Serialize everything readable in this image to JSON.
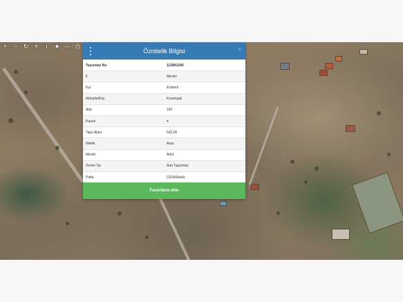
{
  "toolbar": {
    "icons": [
      "plus-icon",
      "minus-icon",
      "refresh-icon",
      "locate-icon",
      "info-icon",
      "star-icon",
      "measure-icon",
      "print-icon"
    ],
    "glyphs": [
      "+",
      "−",
      "↻",
      "⌖",
      "i",
      "★",
      "—",
      "⎙"
    ]
  },
  "dialog": {
    "title": "Öznitelik Bilgisi",
    "close_glyph": "×",
    "rows": [
      {
        "key": "Taşınmaz No",
        "value": "113841266"
      },
      {
        "key": "İl",
        "value": "Mersin"
      },
      {
        "key": "İlçe",
        "value": "Erdemli"
      },
      {
        "key": "Mahalle/Köy",
        "value": "Koramşalı"
      },
      {
        "key": "Ada",
        "value": "162"
      },
      {
        "key": "Parsel",
        "value": "4"
      },
      {
        "key": "Tapu Alanı",
        "value": "532,00"
      },
      {
        "key": "Nitelik",
        "value": "Arsa"
      },
      {
        "key": "Mevkii",
        "value": "Arkit"
      },
      {
        "key": "Zemin Tip",
        "value": "Ana Taşınmaz"
      },
      {
        "key": "Pafta",
        "value": "O32d04a4a"
      }
    ],
    "favorite_label": "Favorilere ekle"
  },
  "colors": {
    "header": "#337ab7",
    "favorite": "#5cb85c"
  }
}
